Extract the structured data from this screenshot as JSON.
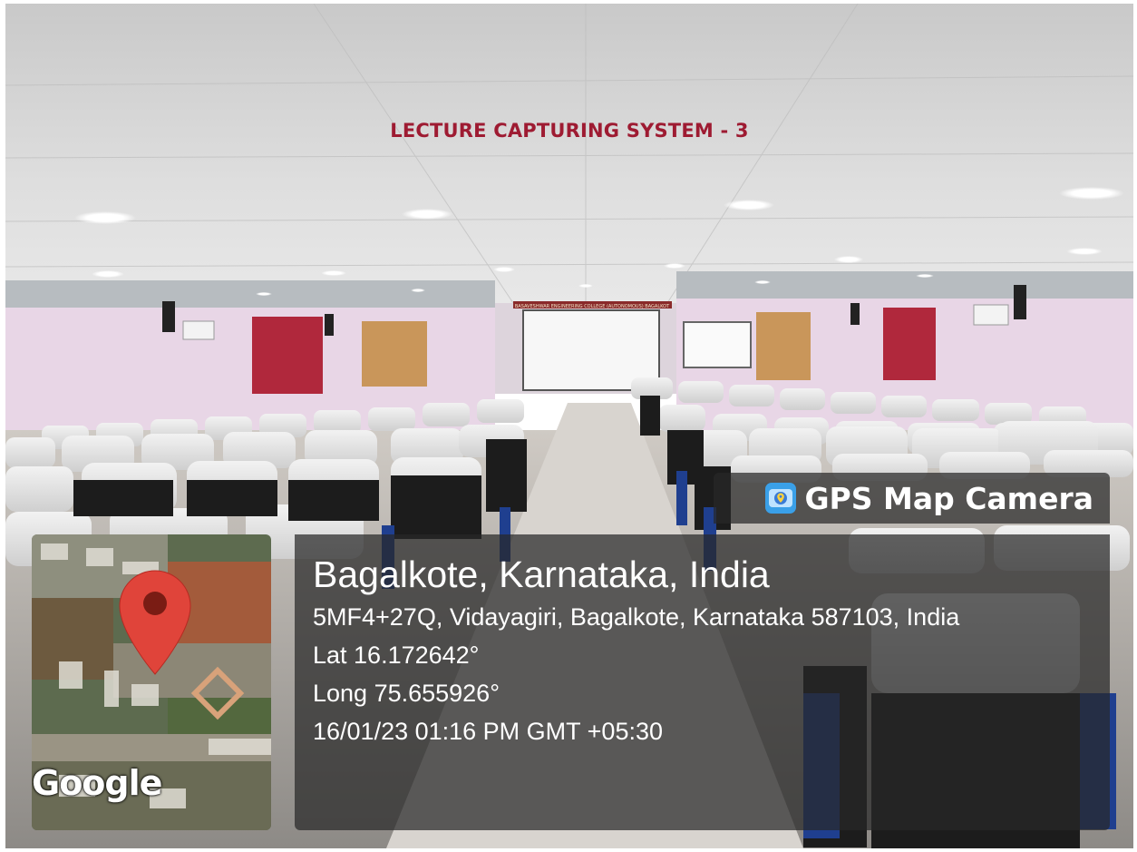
{
  "photo": {
    "description_icon": "camera-photo"
  },
  "caption": "LECTURE CAPTURING SYSTEM - 3",
  "banner": "BASAVESHWAR ENGINEERING COLLEGE (AUTONOMOUS) BAGALKOT",
  "stamp": {
    "app_name": "GPS Map Camera",
    "map_brand": "Google",
    "place": "Bagalkote, Karnataka, India",
    "address": "5MF4+27Q, Vidayagiri, Bagalkote, Karnataka 587103, India",
    "lat": "Lat 16.172642°",
    "long": "Long 75.655926°",
    "datetime": "16/01/23 01:16 PM GMT +05:30"
  },
  "colors": {
    "caption": "#9e1b32",
    "pin": "#e0443a",
    "overlay": "#282828",
    "wall": "#e8d6e6",
    "curtain": "#b0283c"
  }
}
